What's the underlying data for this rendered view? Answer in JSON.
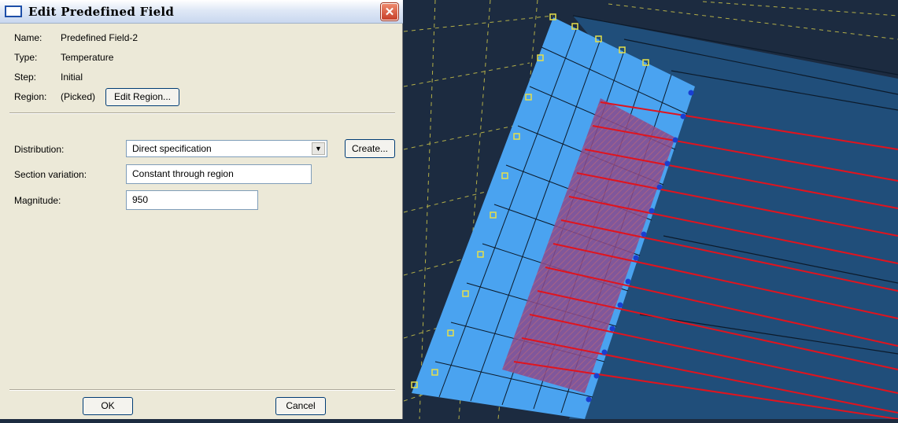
{
  "dialog": {
    "title": "Edit Predefined Field",
    "close_glyph": "✕",
    "name_label": "Name:",
    "name_value": "Predefined Field-2",
    "type_label": "Type:",
    "type_value": "Temperature",
    "step_label": "Step:",
    "step_value": "Initial",
    "region_label": "Region:",
    "region_value": "(Picked)",
    "edit_region_button": "Edit Region...",
    "distribution_label": "Distribution:",
    "distribution_value": "Direct specification",
    "create_button": "Create...",
    "section_variation_label": "Section variation:",
    "section_variation_value": "Constant through region",
    "magnitude_label": "Magnitude:",
    "magnitude_value": "950",
    "ok_button": "OK",
    "cancel_button": "Cancel"
  },
  "icons": {
    "window": "window-icon",
    "close": "close-icon",
    "dropdown": "chevron-down-icon"
  },
  "colors": {
    "dialog_bg": "#ece9d8",
    "viewport_bg": "#1c2b40",
    "mesh_blue": "#4aa3f0",
    "constraint_red": "#e0141e",
    "node_yellow": "#e6e04a"
  }
}
